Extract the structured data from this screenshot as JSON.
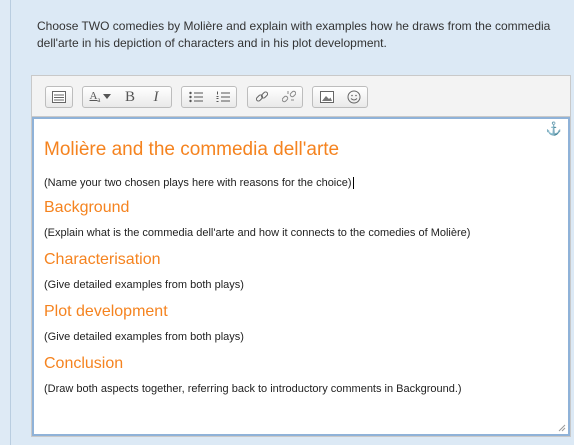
{
  "question": {
    "text": "Choose TWO comedies by Molière and explain with examples how he draws from the commedia dell'arte in his depiction of characters and in his plot development."
  },
  "toolbar": {
    "font_label": "A",
    "bold": "B",
    "italic": "I"
  },
  "content": {
    "title": "Molière and the commedia dell'arte",
    "intro": "(Name your two chosen plays here with reasons for the choice)",
    "sections": [
      {
        "heading": "Background",
        "body": "(Explain what is the commedia dell'arte and how it connects to the comedies of Molière)"
      },
      {
        "heading": "Characterisation",
        "body": "(Give detailed examples from both plays)"
      },
      {
        "heading": "Plot development",
        "body": "(Give detailed examples from both plays)"
      },
      {
        "heading": "Conclusion",
        "body": "(Draw both aspects together, referring back to introductory comments in Background.)"
      }
    ]
  },
  "colors": {
    "heading": "#f5831f",
    "focus_border": "#8fb2d8",
    "background": "#dce9f5"
  },
  "icons": [
    "show-more-icon",
    "font-style-icon",
    "chevron-down-icon",
    "bold-icon",
    "italic-icon",
    "unordered-list-icon",
    "ordered-list-icon",
    "link-icon",
    "unlink-icon",
    "image-icon",
    "emoticon-icon",
    "anchor-icon",
    "resize-handle-icon"
  ]
}
